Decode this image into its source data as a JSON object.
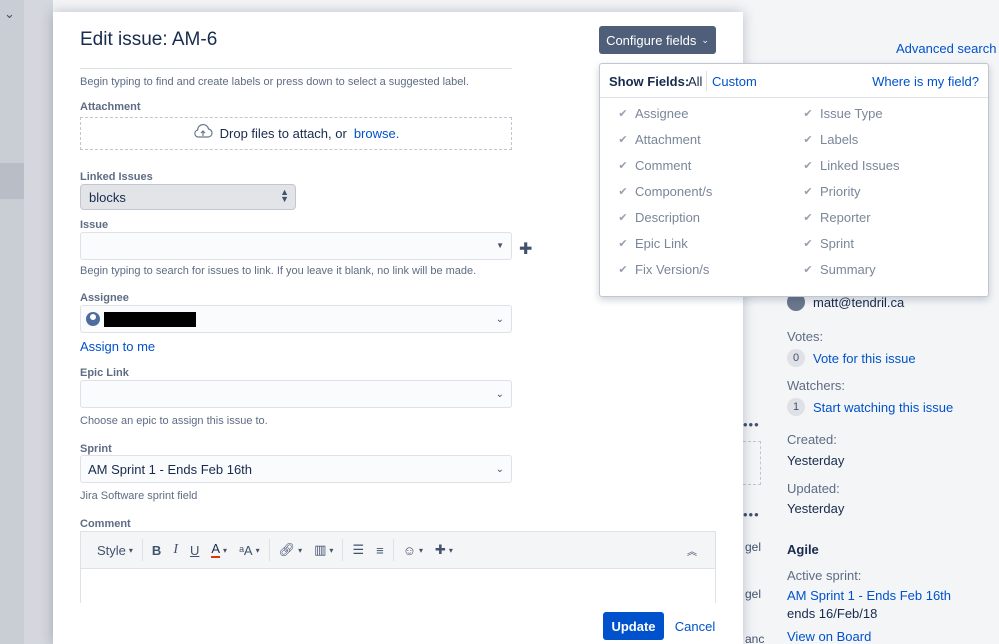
{
  "background": {
    "advanced_search": "Advanced search",
    "reporter_email": "matt@tendril.ca",
    "votes_label": "Votes:",
    "votes_count": "0",
    "vote_link": "Vote for this issue",
    "watchers_label": "Watchers:",
    "watchers_count": "1",
    "watch_link": "Start watching this issue",
    "created_label": "Created:",
    "created_value": "Yesterday",
    "updated_label": "Updated:",
    "updated_value": "Yesterday",
    "agile_heading": "Agile",
    "active_sprint_label": "Active sprint:",
    "active_sprint_link": "AM Sprint 1 - Ends Feb 16th",
    "sprint_ends": "ends 16/Feb/18",
    "view_on_board": "View on Board",
    "dots": "•••",
    "frag_gel": "gel",
    "frag_anc": "anc"
  },
  "modal": {
    "title": "Edit issue: AM-6",
    "configure_label": "Configure fields",
    "labels_help": "Begin typing to find and create labels or press down to select a suggested label.",
    "attachment_label": "Attachment",
    "drop_text": "Drop files to attach, or",
    "browse_text": "browse.",
    "linked_issues_label": "Linked Issues",
    "linked_issues_value": "blocks",
    "issue_label": "Issue",
    "issue_help": "Begin typing to search for issues to link. If you leave it blank, no link will be made.",
    "assignee_label": "Assignee",
    "assign_to_me": "Assign to me",
    "epic_link_label": "Epic Link",
    "epic_help": "Choose an epic to assign this issue to.",
    "sprint_label": "Sprint",
    "sprint_value": "AM Sprint 1 - Ends Feb 16th",
    "sprint_help": "Jira Software sprint field",
    "comment_label": "Comment",
    "toolbar": {
      "style": "Style",
      "bold": "B",
      "italic": "I",
      "underline": "U",
      "text_color": "A",
      "text_size": "ᵃA"
    },
    "update_label": "Update",
    "cancel_label": "Cancel"
  },
  "configure_popup": {
    "show_fields_label": "Show Fields:",
    "option_all": "All",
    "option_custom": "Custom",
    "where_link": "Where is my field?",
    "left_fields": [
      "Assignee",
      "Attachment",
      "Comment",
      "Component/s",
      "Description",
      "Epic Link",
      "Fix Version/s"
    ],
    "right_fields": [
      "Issue Type",
      "Labels",
      "Linked Issues",
      "Priority",
      "Reporter",
      "Sprint",
      "Summary"
    ]
  },
  "icons": {
    "chevron": "chevron-down-icon",
    "cloud": "upload-cloud-icon",
    "check": "checkmark-icon",
    "plus": "plus-icon"
  }
}
